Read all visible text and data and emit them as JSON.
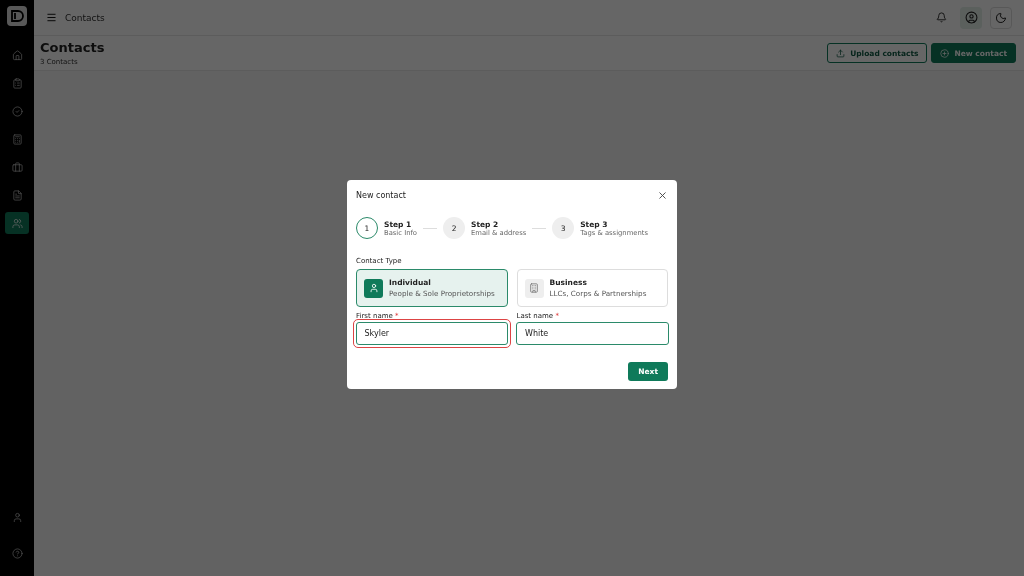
{
  "sidebar": {
    "items": [
      {
        "selected": false
      },
      {
        "selected": false
      },
      {
        "selected": false
      },
      {
        "selected": false
      },
      {
        "selected": false
      },
      {
        "selected": false
      },
      {
        "selected": true
      }
    ]
  },
  "topbar": {
    "breadcrumb": "Contacts"
  },
  "page": {
    "title": "Contacts",
    "subtitle": "3 Contacts",
    "buttons": [
      {
        "kind": "outline",
        "label": "Upload contacts"
      },
      {
        "kind": "primary",
        "label": "New contact"
      }
    ]
  },
  "dialog": {
    "title": "New contact",
    "steps": [
      {
        "number": "1",
        "title": "Step 1",
        "subtitle": "Basic Info",
        "selected": true
      },
      {
        "number": "2",
        "title": "Step 2",
        "subtitle": "Email & address",
        "selected": false
      },
      {
        "number": "3",
        "title": "Step 3",
        "subtitle": "Tags & assignments",
        "selected": false
      }
    ],
    "contact_type_label": "Contact Type",
    "contact_types": [
      {
        "kind": "person",
        "title": "Individual",
        "subtitle": "People & Sole Proprietorships",
        "selected": true
      },
      {
        "kind": "building",
        "title": "Business",
        "subtitle": "LLCs, Corps & Partnerships",
        "selected": false
      }
    ],
    "fields": [
      {
        "label": "First name",
        "required_mark": "*",
        "value": "Skyler",
        "highlighted": true
      },
      {
        "label": "Last name",
        "required_mark": "*",
        "value": "White",
        "highlighted": false
      }
    ],
    "next_button": "Next"
  }
}
